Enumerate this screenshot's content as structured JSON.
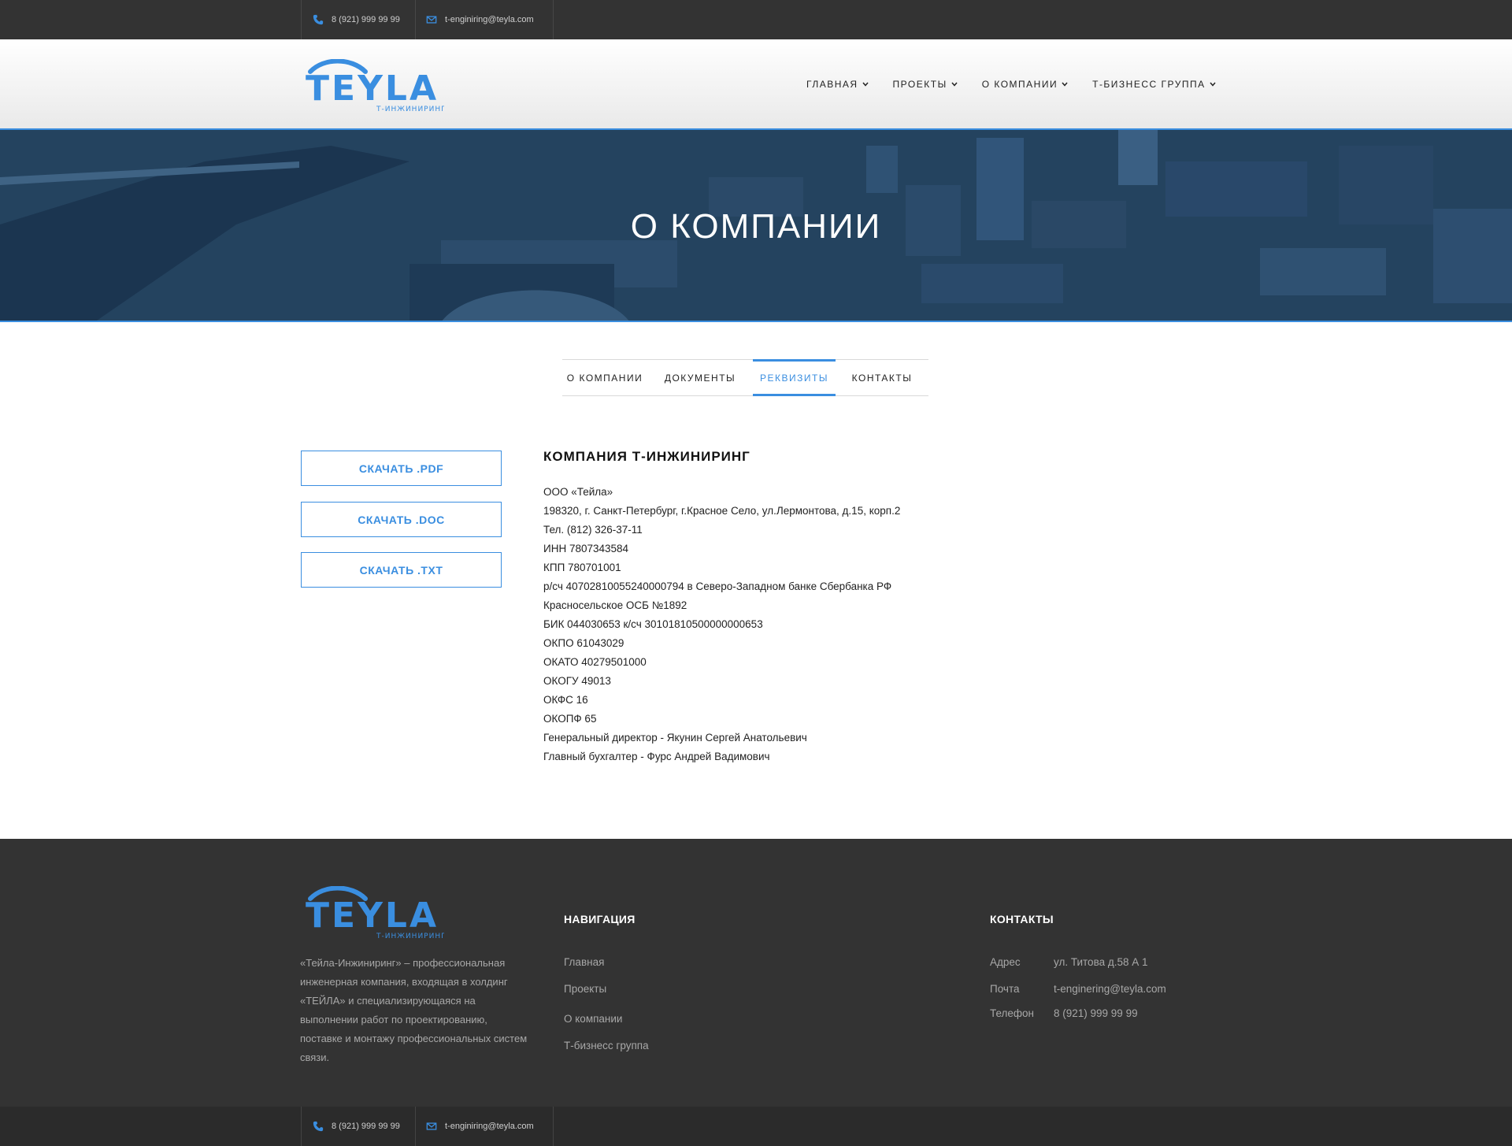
{
  "topbar": {
    "phone": "8 (921) 999 99 99",
    "email": "t-enginiring@teyla.com"
  },
  "header": {
    "logo_text": "TEYLA",
    "logo_sub": "Т-ИНЖИНИРИНГ",
    "nav": [
      {
        "label": "ГЛАВНАЯ"
      },
      {
        "label": "ПРОЕКТЫ"
      },
      {
        "label": "О КОМПАНИИ"
      },
      {
        "label": "Т-БИЗНЕСС ГРУППА"
      }
    ]
  },
  "hero": {
    "title": "О КОМПАНИИ"
  },
  "tabs": [
    {
      "label": "О КОМПАНИИ"
    },
    {
      "label": "ДОКУМЕНТЫ"
    },
    {
      "label": "РЕКВИЗИТЫ",
      "active": true
    },
    {
      "label": "КОНТАКТЫ"
    }
  ],
  "downloads": [
    {
      "label": "СКАЧАТЬ .PDF"
    },
    {
      "label": "СКАЧАТЬ .DOC"
    },
    {
      "label": "СКАЧАТЬ .TXT"
    }
  ],
  "details": {
    "title": "КОМПАНИЯ Т-ИНЖИНИРИНГ",
    "lines": [
      "ООО «Тейла»",
      "198320, г. Санкт-Петербург, г.Красное Село, ул.Лермонтова, д.15, корп.2",
      "Тел. (812) 326-37-11",
      "ИНН 7807343584",
      "КПП 780701001",
      "р/сч 40702810055240000794 в Северо-Западном банке Сбербанка РФ",
      "Красносельское ОСБ №1892",
      "БИК 044030653 к/сч 30101810500000000653",
      "ОКПО 61043029",
      "ОКАТО 40279501000",
      "ОКОГУ 49013",
      "ОКФС 16",
      "ОКОПФ 65",
      "Генеральный директор - Якунин Сергей Анатольевич",
      "Главный бухгалтер - Фурс Андрей Вадимович"
    ]
  },
  "footer": {
    "about": "«Тейла-Инжиниринг» – профессиональная инженерная компания, входящая в холдинг «ТЕЙЛА» и специализирующаяся на выполнении работ по проектированию, поставке и монтажу профессиональных систем связи.",
    "nav_title": "НАВИГАЦИЯ",
    "nav_links": [
      "Главная",
      "Проекты",
      "О компании",
      "Т-бизнесс группа"
    ],
    "contacts_title": "КОНТАКТЫ",
    "contacts": [
      {
        "label": "Адрес",
        "value": "ул. Титова д.58 А 1"
      },
      {
        "label": "Почта",
        "value": "t-enginering@teyla.com"
      },
      {
        "label": "Телефон",
        "value": "8 (921) 999 99 99"
      }
    ]
  },
  "bottombar": {
    "phone": "8 (921) 999 99 99",
    "email": "t-enginiring@teyla.com"
  },
  "colors": {
    "accent": "#3a8ee0",
    "dark": "#333333",
    "hero": "#24435f"
  }
}
